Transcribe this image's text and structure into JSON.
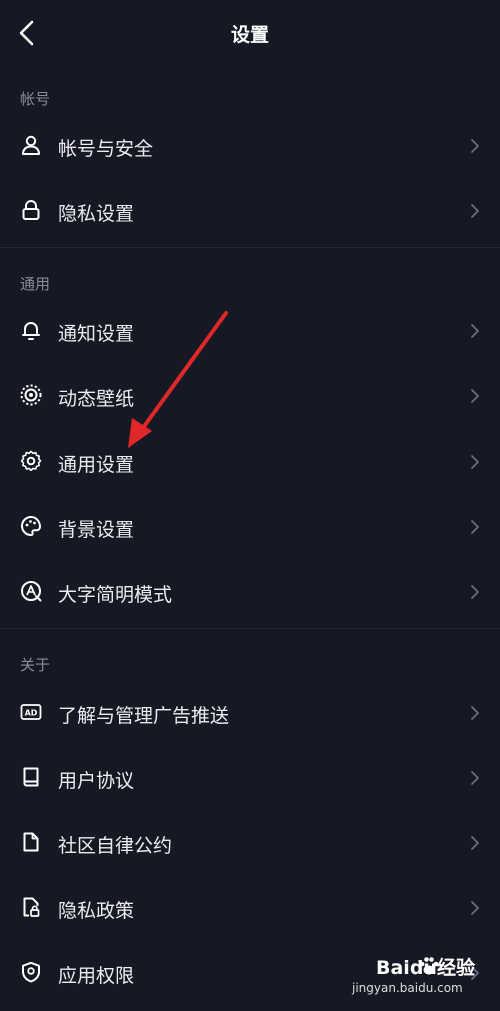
{
  "header": {
    "title": "设置"
  },
  "sections": [
    {
      "label": "帐号",
      "items": [
        {
          "label": "帐号与安全",
          "icon": "user-icon"
        },
        {
          "label": "隐私设置",
          "icon": "lock-icon"
        }
      ]
    },
    {
      "label": "通用",
      "items": [
        {
          "label": "通知设置",
          "icon": "bell-icon"
        },
        {
          "label": "动态壁纸",
          "icon": "live-wallpaper-icon"
        },
        {
          "label": "通用设置",
          "icon": "gear-icon"
        },
        {
          "label": "背景设置",
          "icon": "palette-icon"
        },
        {
          "label": "大字简明模式",
          "icon": "large-text-mode-icon"
        }
      ]
    },
    {
      "label": "关于",
      "items": [
        {
          "label": "了解与管理广告推送",
          "icon": "ad-icon"
        },
        {
          "label": "用户协议",
          "icon": "book-icon"
        },
        {
          "label": "社区自律公约",
          "icon": "document-icon"
        },
        {
          "label": "隐私政策",
          "icon": "privacy-document-icon"
        },
        {
          "label": "应用权限",
          "icon": "shield-icon"
        }
      ]
    }
  ],
  "watermark": {
    "brand": "Baidu经验",
    "url": "jingyan.baidu.com"
  },
  "colors": {
    "background": "#161824",
    "text": "#ececf1",
    "section_label": "#8b8c98",
    "annotation_arrow": "#e02828"
  }
}
